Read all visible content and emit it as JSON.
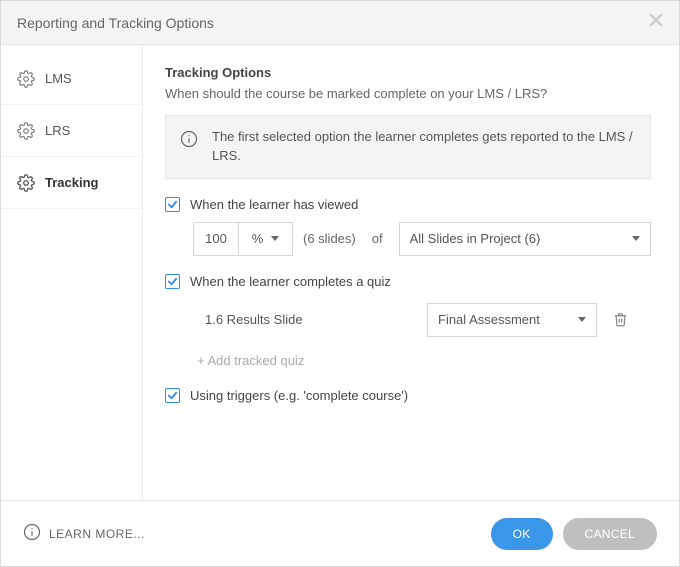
{
  "window": {
    "title": "Reporting and Tracking Options"
  },
  "sidebar": {
    "items": [
      {
        "label": "LMS"
      },
      {
        "label": "LRS"
      },
      {
        "label": "Tracking"
      }
    ]
  },
  "tracking": {
    "title": "Tracking Options",
    "subtitle": "When should the course be marked complete on your LMS / LRS?",
    "info": "The first selected option the learner completes gets reported to the LMS / LRS.",
    "viewed": {
      "label": "When the learner has viewed",
      "value": "100",
      "unit": "%",
      "slides_hint": "(6 slides)",
      "of_label": "of",
      "scope": "All Slides in Project (6)"
    },
    "quiz": {
      "label": "When the learner completes a quiz",
      "item_name": "1.6 Results Slide",
      "selected": "Final Assessment",
      "add_label": "+ Add tracked quiz"
    },
    "triggers": {
      "label": "Using triggers (e.g. 'complete course')"
    }
  },
  "footer": {
    "learn_more": "LEARN MORE...",
    "ok": "OK",
    "cancel": "CANCEL"
  }
}
